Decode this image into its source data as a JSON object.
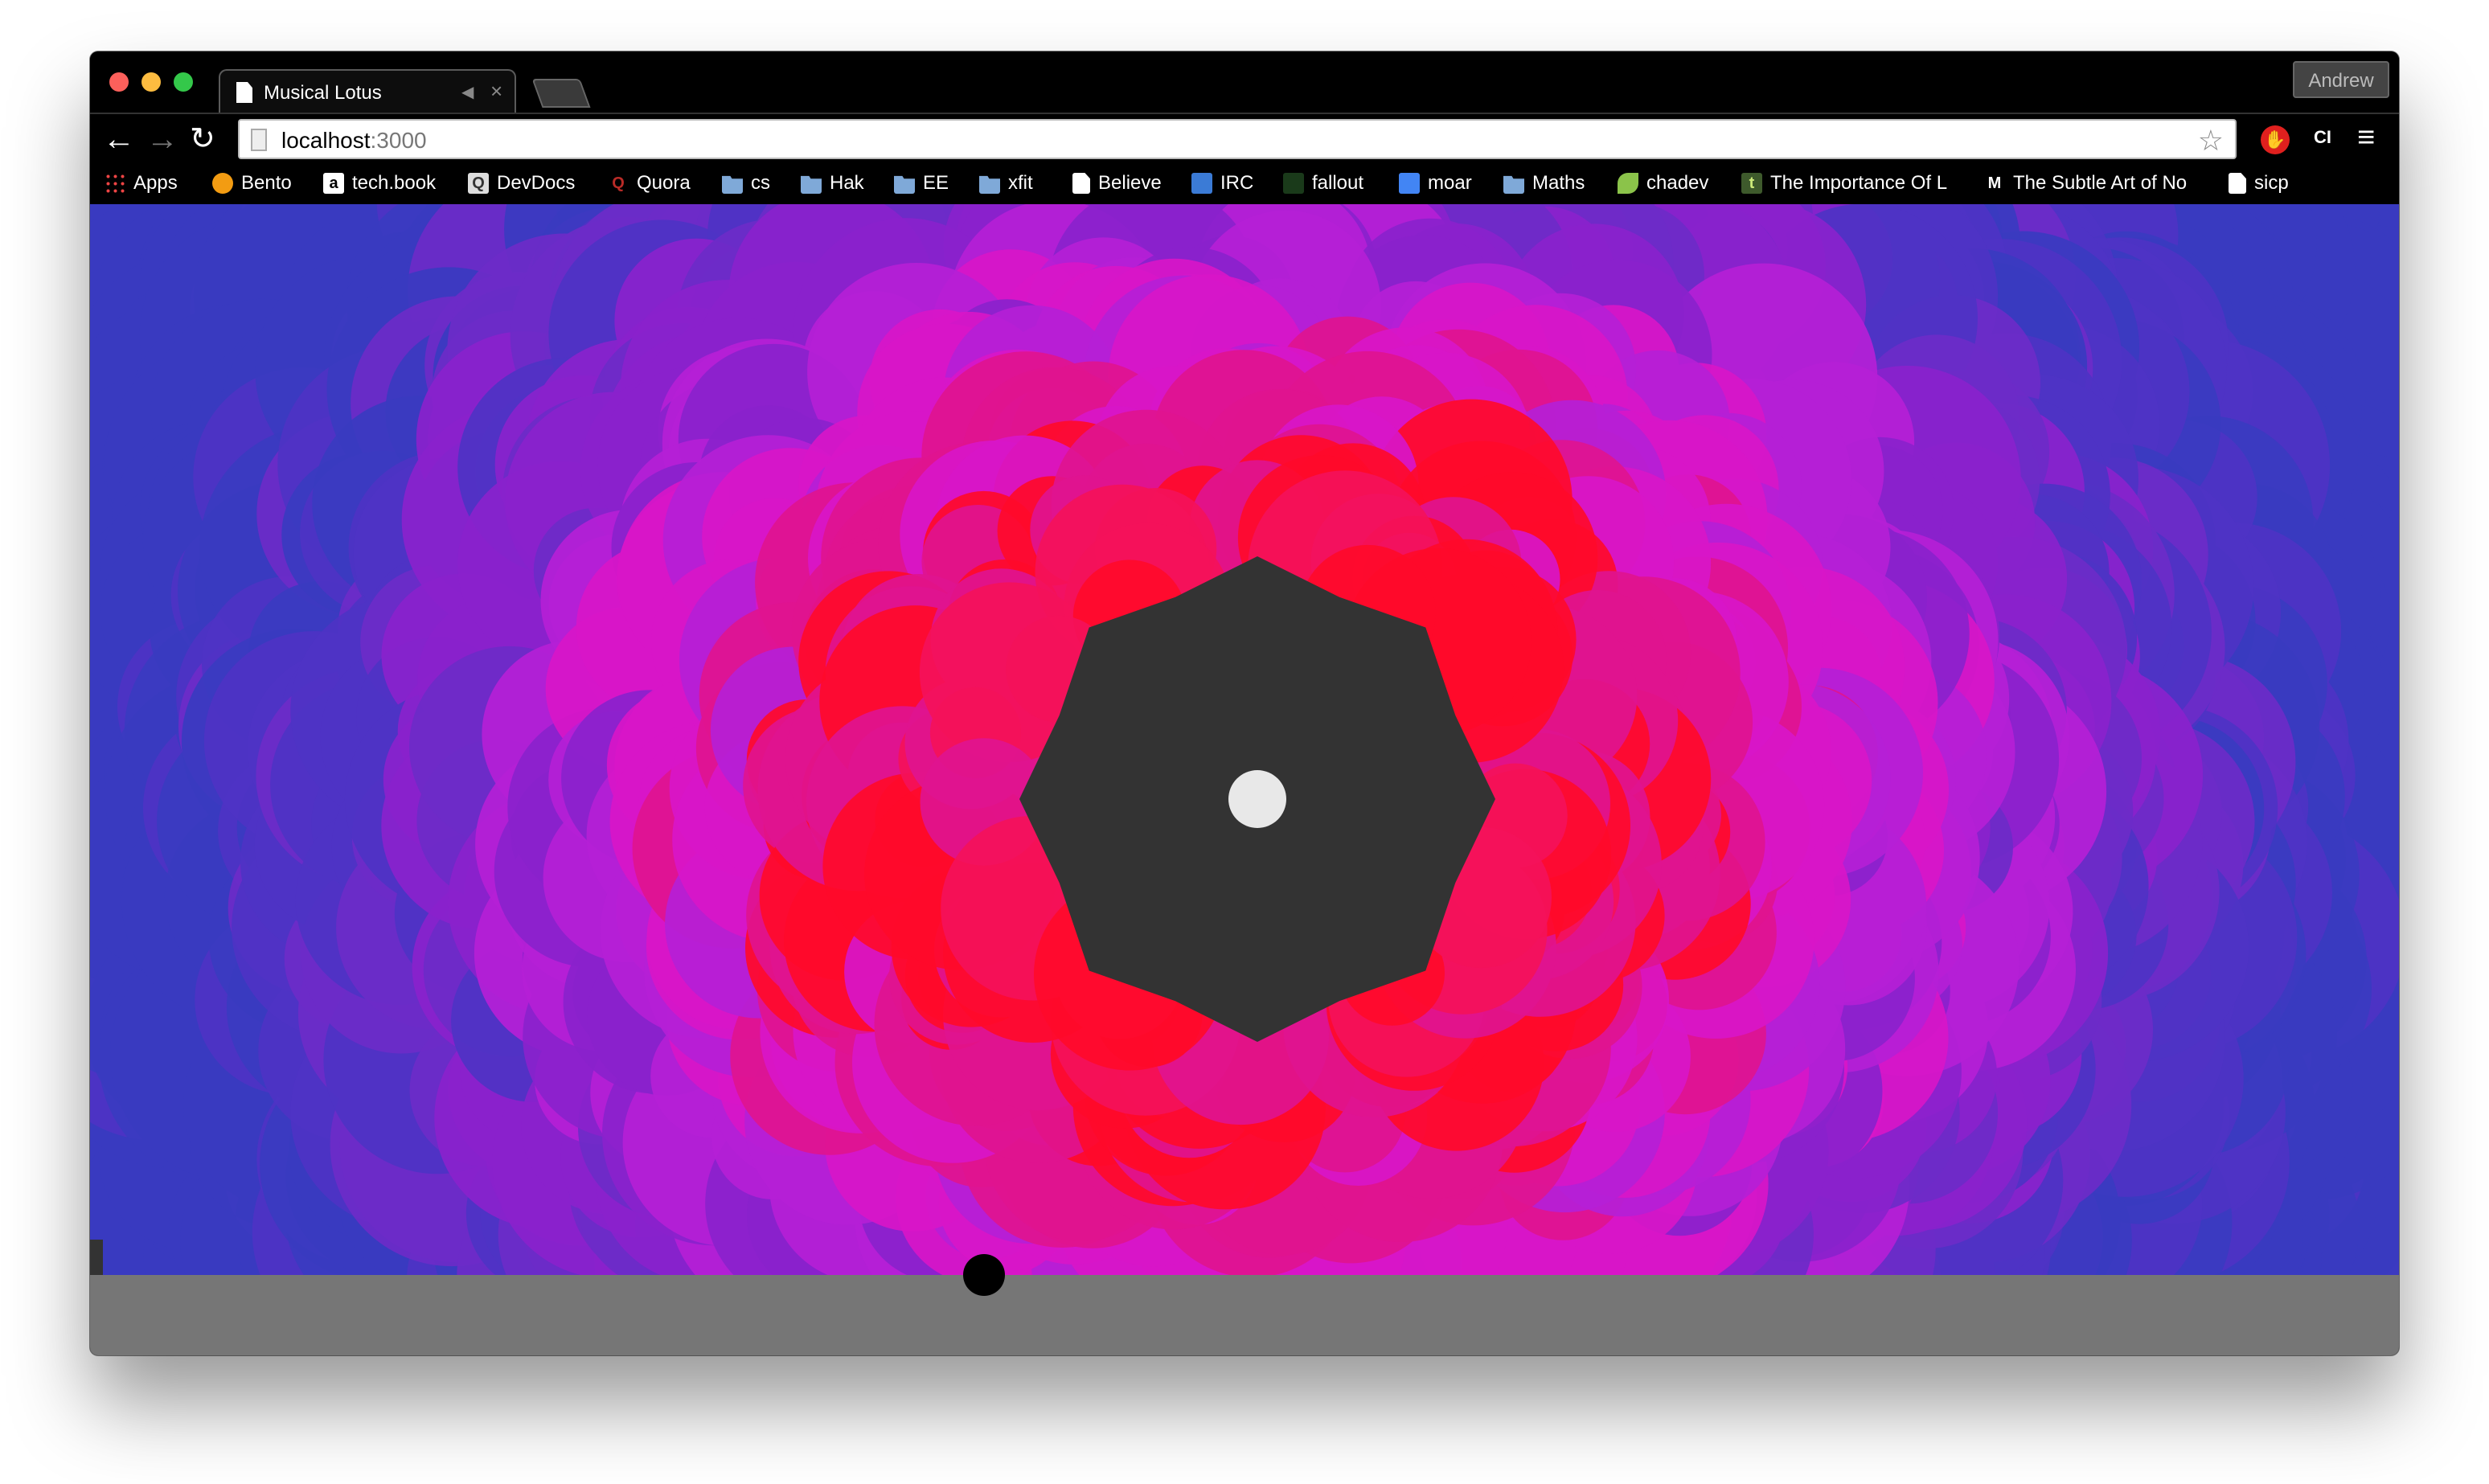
{
  "window": {
    "tab_title": "Musical Lotus",
    "profile_name": "Andrew",
    "tab_audio_icon": "speaker-icon",
    "tab_close": "×"
  },
  "toolbar": {
    "back": "←",
    "forward": "→",
    "reload": "↻",
    "url_host": "localhost",
    "url_port": ":3000",
    "star": "☆",
    "extension_label": "",
    "ci_label": "CI",
    "menu": "≡"
  },
  "bookmarks": [
    {
      "label": "Apps",
      "icon": "apps-icon"
    },
    {
      "label": "Bento",
      "icon": "bento-icon"
    },
    {
      "label": "tech.book",
      "icon": "amazon-icon",
      "glyph": "a"
    },
    {
      "label": "DevDocs",
      "icon": "devdocs-icon",
      "glyph": "Q"
    },
    {
      "label": "Quora",
      "icon": "quora-icon",
      "glyph": "Q"
    },
    {
      "label": "cs",
      "icon": "folder-icon"
    },
    {
      "label": "Hak",
      "icon": "folder-icon"
    },
    {
      "label": "EE",
      "icon": "folder-icon"
    },
    {
      "label": "xfit",
      "icon": "folder-icon"
    },
    {
      "label": "Believe",
      "icon": "page-icon"
    },
    {
      "label": "IRC",
      "icon": "irc-icon"
    },
    {
      "label": "fallout",
      "icon": "fallout-icon"
    },
    {
      "label": "moar",
      "icon": "docs-icon"
    },
    {
      "label": "Maths",
      "icon": "folder-icon"
    },
    {
      "label": "chadev",
      "icon": "leaf-icon"
    },
    {
      "label": "The Importance Of L",
      "icon": "t-icon",
      "glyph": "t"
    },
    {
      "label": "The Subtle Art of No",
      "icon": "medium-icon",
      "glyph": "M"
    },
    {
      "label": "sicp",
      "icon": "page-icon"
    }
  ],
  "visualization": {
    "center_color": "#333333",
    "center_dot_color": "#e8e8e8",
    "palette": [
      "#f4115a",
      "#ff0a2a",
      "#e0138f",
      "#d816c8",
      "#b51fd6",
      "#8a22cc",
      "#6d2bc8",
      "#4e33c4",
      "#3a3bc0"
    ]
  },
  "colors": {
    "background_magenta": "#e2168a",
    "bottom_bar": "#767676",
    "knob": "#000000"
  }
}
